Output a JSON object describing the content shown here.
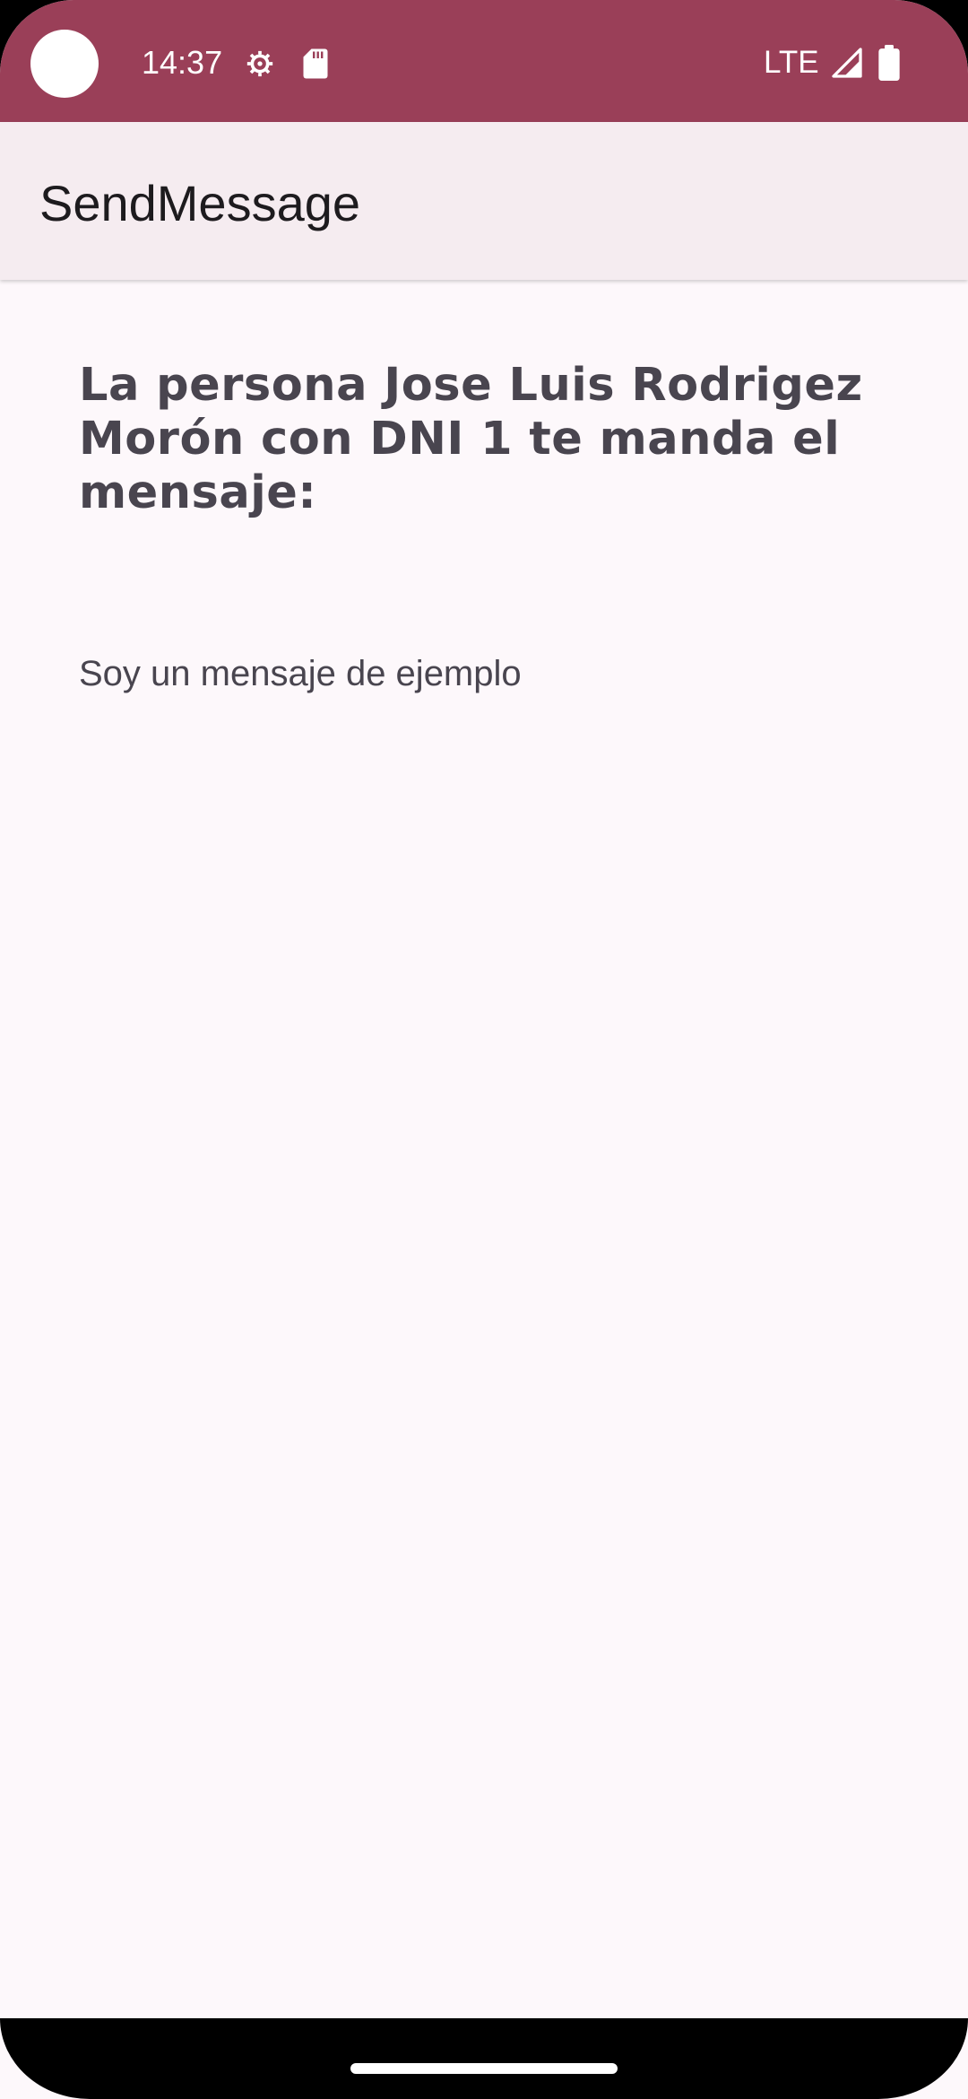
{
  "status_bar": {
    "time": "14:37",
    "network": "LTE",
    "icons": [
      "settings-gear-icon",
      "sd-card-icon",
      "signal-icon",
      "battery-icon"
    ],
    "background_color": "#9a3f58"
  },
  "app_bar": {
    "title": "SendMessage",
    "background_color": "#f5ecf0"
  },
  "message": {
    "heading": "La persona Jose Luis Rodrigez Morón con DNI 1 te manda el mensaje:",
    "body": "Soy un mensaje de ejemplo"
  },
  "colors": {
    "screen_background": "#fdf8fb",
    "text_secondary": "#49454f"
  }
}
